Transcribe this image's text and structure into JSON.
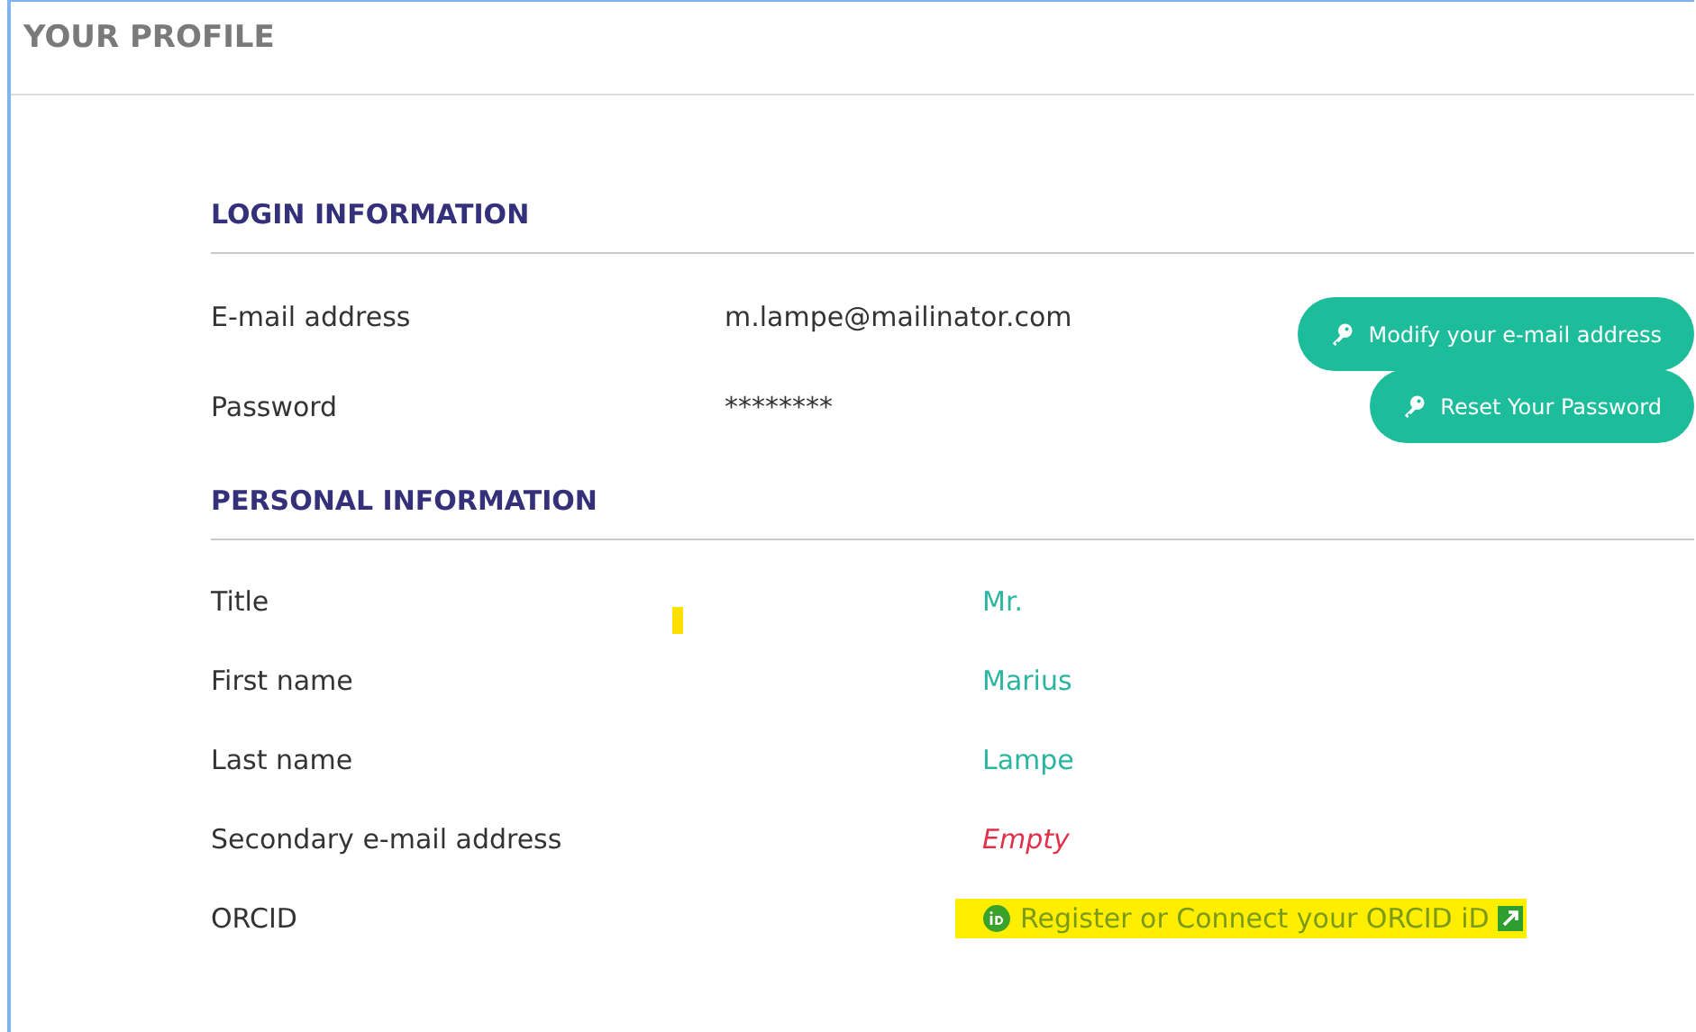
{
  "header": {
    "title": "YOUR PROFILE"
  },
  "login": {
    "heading": "LOGIN INFORMATION",
    "rows": [
      {
        "label": "E-mail address",
        "value": "m.lampe@mailinator.com",
        "button": "Modify your e-mail address"
      },
      {
        "label": "Password",
        "value": "********",
        "button": "Reset Your Password"
      }
    ]
  },
  "personal": {
    "heading": "PERSONAL INFORMATION",
    "rows": [
      {
        "label": "Title",
        "value": "Mr.",
        "kind": "text"
      },
      {
        "label": "First name",
        "value": "Marius",
        "kind": "text"
      },
      {
        "label": "Last name",
        "value": "Lampe",
        "kind": "text"
      },
      {
        "label": "Secondary e-mail address",
        "value": "Empty",
        "kind": "empty"
      },
      {
        "label": "ORCID",
        "value": "Register or Connect your ORCID iD",
        "kind": "link",
        "highlighted": true
      }
    ]
  }
}
